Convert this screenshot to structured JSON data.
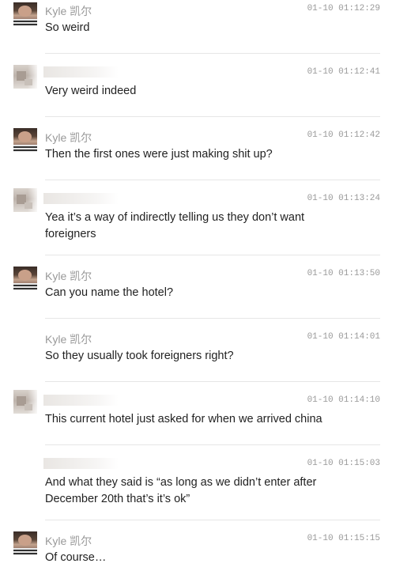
{
  "messages": [
    {
      "sender": "Kyle 凯尔",
      "time": "01-10 01:12:29",
      "text": "So weird",
      "avatar": "kyle-avatar"
    },
    {
      "sender": "",
      "time": "01-10 01:12:41",
      "text": "Very weird indeed",
      "avatar": "blurred-avatar"
    },
    {
      "sender": "Kyle 凯尔",
      "time": "01-10 01:12:42",
      "text": "Then the first ones were just making shit up?",
      "avatar": "kyle-avatar"
    },
    {
      "sender": "",
      "time": "01-10 01:13:24",
      "text": "Yea it’s a way of indirectly telling us they don’t want foreigners",
      "avatar": "blurred-avatar"
    },
    {
      "sender": "Kyle 凯尔",
      "time": "01-10 01:13:50",
      "text": "Can you name the hotel?",
      "avatar": "kyle-avatar"
    },
    {
      "sender": "Kyle 凯尔",
      "time": "01-10 01:14:01",
      "text": "So they usually took foreigners right?",
      "avatar": "none"
    },
    {
      "sender": "",
      "time": "01-10 01:14:10",
      "text": "This current hotel just asked for when we arrived china",
      "avatar": "blurred-avatar"
    },
    {
      "sender": "",
      "time": "01-10 01:15:03",
      "text": "And what they said is “as long as we didn’t enter after December 20th that’s it’s ok”",
      "avatar": "none"
    },
    {
      "sender": "Kyle 凯尔",
      "time": "01-10 01:15:15",
      "text": "Of course…",
      "avatar": "kyle-avatar"
    }
  ]
}
